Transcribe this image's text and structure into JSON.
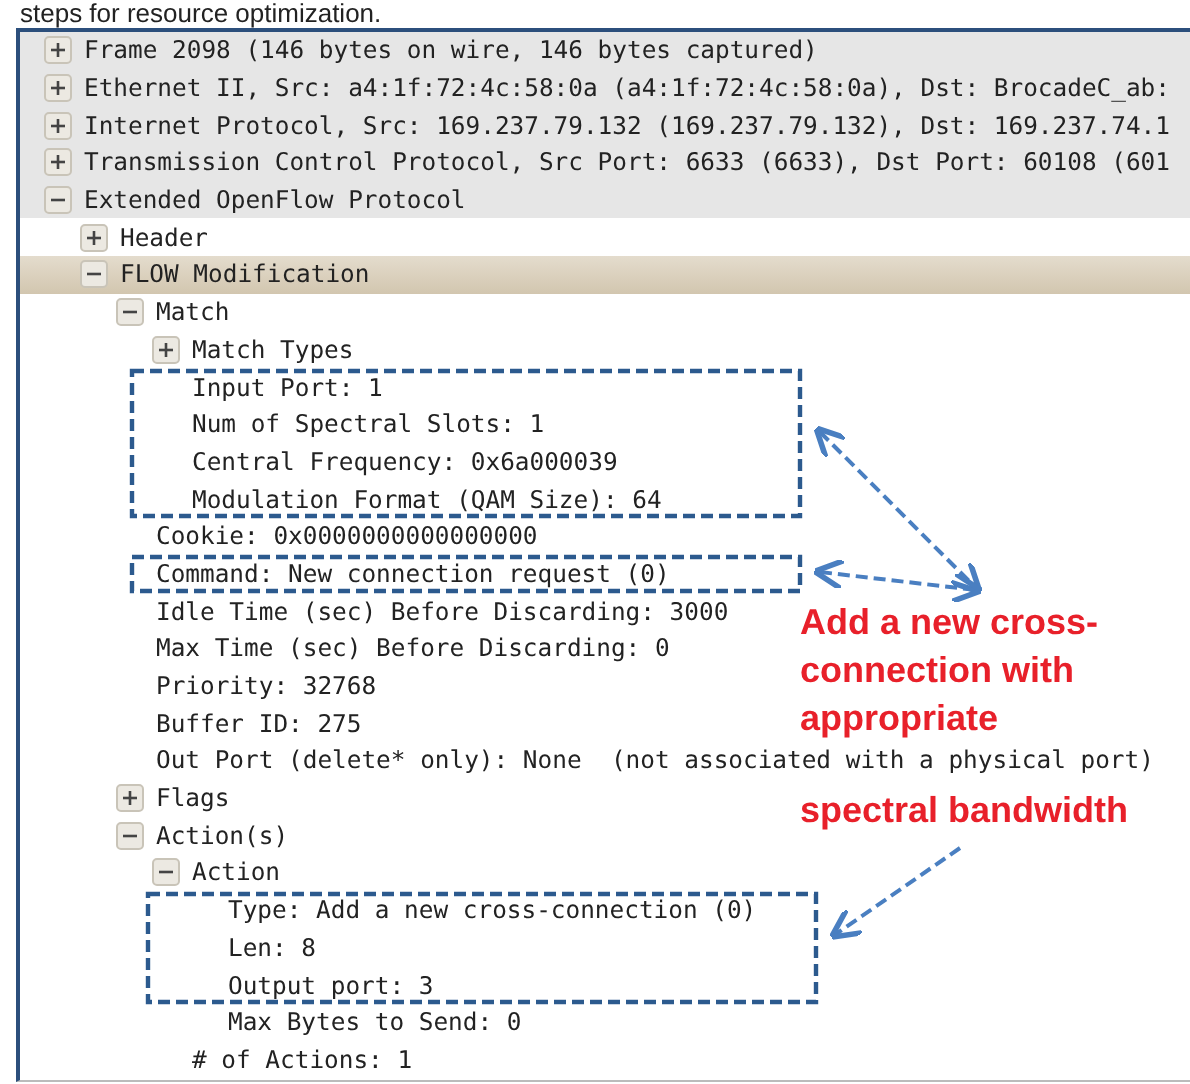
{
  "caption": "steps for resource optimization.",
  "tree": [
    {
      "label": "Frame 2098 (146 bytes on wire, 146 bytes captured)",
      "kind": "group",
      "expanded": false,
      "selected": false
    },
    {
      "label": "Ethernet II, Src: a4:1f:72:4c:58:0a (a4:1f:72:4c:58:0a), Dst: BrocadeC_ab:",
      "kind": "group",
      "expanded": false,
      "selected": false
    },
    {
      "label": "Internet Protocol, Src: 169.237.79.132 (169.237.79.132), Dst: 169.237.74.1",
      "kind": "group",
      "expanded": false,
      "selected": false
    },
    {
      "label": "Transmission Control Protocol, Src Port: 6633 (6633), Dst Port: 60108 (601",
      "kind": "group",
      "expanded": false,
      "selected": false
    },
    {
      "label": "Extended OpenFlow Protocol",
      "kind": "group",
      "expanded": true,
      "selected": false,
      "children": [
        {
          "label": "Header",
          "kind": "group",
          "expanded": false,
          "selected": false
        },
        {
          "label": "FLOW Modification",
          "kind": "group",
          "expanded": true,
          "selected": true,
          "children": [
            {
              "label": "Match",
              "kind": "group",
              "expanded": true,
              "selected": false,
              "children": [
                {
                  "label": "Match Types",
                  "kind": "group",
                  "expanded": false,
                  "selected": false
                },
                {
                  "label": "Input Port: 1",
                  "kind": "leaf",
                  "selected": false
                },
                {
                  "label": "Num of Spectral Slots: 1",
                  "kind": "leaf",
                  "selected": false
                },
                {
                  "label": "Central Frequency: 0x6a000039",
                  "kind": "leaf",
                  "selected": false
                },
                {
                  "label": "Modulation Format (QAM Size): 64",
                  "kind": "leaf",
                  "selected": false
                }
              ]
            },
            {
              "label": "Cookie: 0x0000000000000000",
              "kind": "leaf",
              "selected": false
            },
            {
              "label": "Command: New connection request (0)",
              "kind": "leaf",
              "selected": false
            },
            {
              "label": "Idle Time (sec) Before Discarding: 3000",
              "kind": "leaf",
              "selected": false
            },
            {
              "label": "Max Time (sec) Before Discarding: 0",
              "kind": "leaf",
              "selected": false
            },
            {
              "label": "Priority: 32768",
              "kind": "leaf",
              "selected": false
            },
            {
              "label": "Buffer ID: 275",
              "kind": "leaf",
              "selected": false
            },
            {
              "label": "Out Port (delete* only): None  (not associated with a physical port)",
              "kind": "leaf",
              "selected": false
            },
            {
              "label": "Flags",
              "kind": "group",
              "expanded": false,
              "selected": false
            },
            {
              "label": "Action(s)",
              "kind": "group",
              "expanded": true,
              "selected": false,
              "children": [
                {
                  "label": "Action",
                  "kind": "group",
                  "expanded": true,
                  "selected": false,
                  "children": [
                    {
                      "label": "Type: Add a new cross-connection (0)",
                      "kind": "leaf",
                      "selected": false
                    },
                    {
                      "label": "Len: 8",
                      "kind": "leaf",
                      "selected": false
                    },
                    {
                      "label": "Output port: 3",
                      "kind": "leaf",
                      "selected": false
                    },
                    {
                      "label": "Max Bytes to Send: 0",
                      "kind": "leaf",
                      "selected": false
                    }
                  ]
                },
                {
                  "label": "# of Actions: 1",
                  "kind": "leaf",
                  "selected": false
                }
              ]
            }
          ]
        }
      ]
    }
  ],
  "annotation": {
    "lines": [
      "Add a new cross-",
      "connection with",
      "appropriate",
      "spectral bandwidth"
    ]
  }
}
